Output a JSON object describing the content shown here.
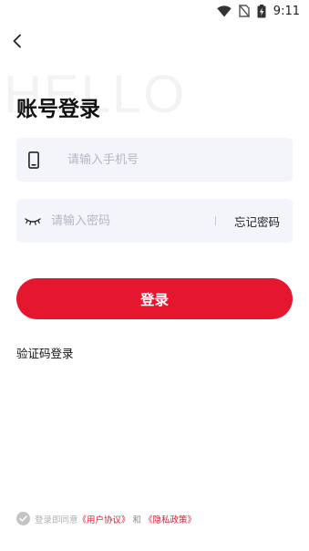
{
  "status_bar": {
    "time": "9:11",
    "icons": [
      "wifi-icon",
      "no-sim-icon",
      "battery-charging-icon"
    ]
  },
  "nav": {
    "back_icon": "chevron-left-icon"
  },
  "watermark": "HELLO",
  "title": "账号登录",
  "phone_field": {
    "icon": "phone-icon",
    "placeholder": "请输入手机号",
    "value": ""
  },
  "password_field": {
    "icon": "eye-closed-icon",
    "placeholder": "请输入密码",
    "value": "",
    "forgot_label": "忘记密码"
  },
  "login_button": "登录",
  "sms_login_label": "验证码登录",
  "agreement": {
    "prefix": "登录即同意",
    "user_agreement": "《用户协议》",
    "and": "和",
    "privacy_policy": "《隐私政策》",
    "checked": true
  },
  "colors": {
    "accent": "#e4172e",
    "field_bg": "#f3f5fb",
    "placeholder": "#b4b8c2"
  }
}
